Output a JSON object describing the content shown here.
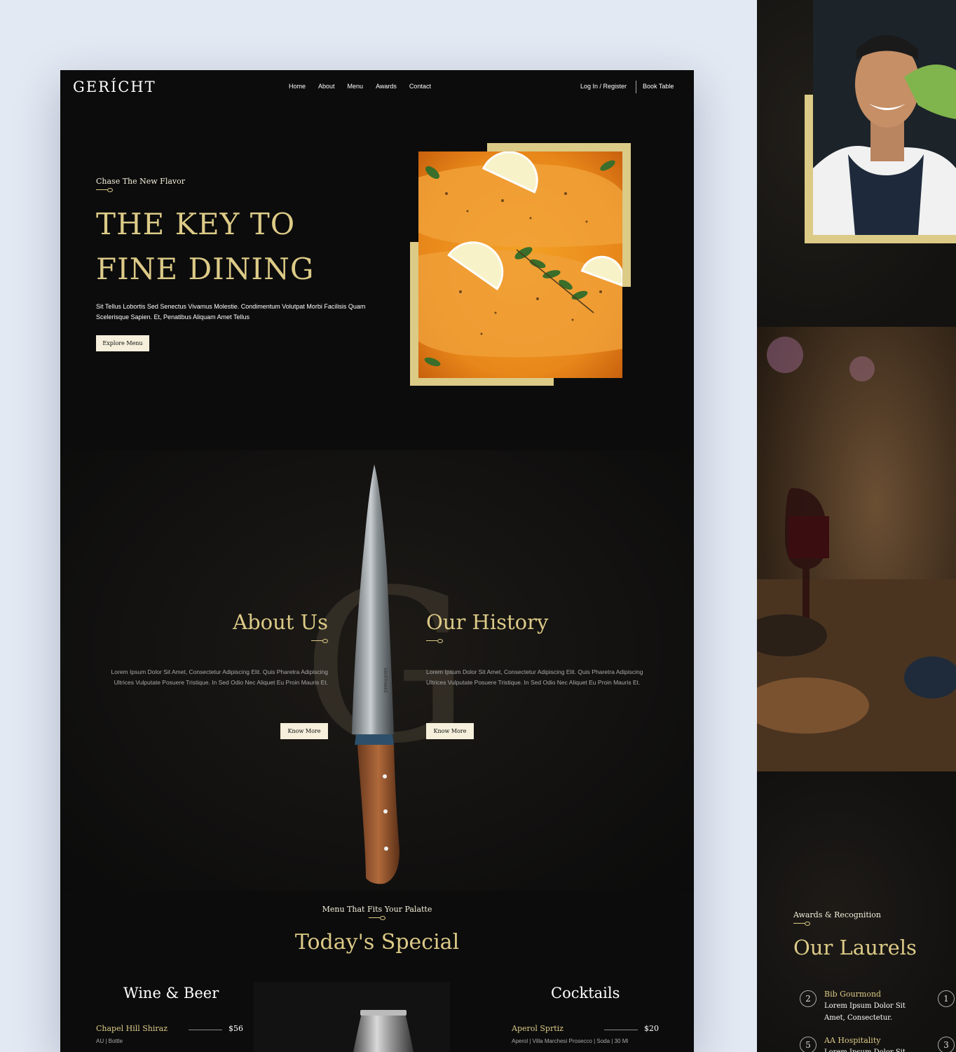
{
  "brand": {
    "logo": "GERÍCHT"
  },
  "nav": {
    "links": [
      "Home",
      "About",
      "Menu",
      "Awards",
      "Contact"
    ],
    "login": "Log In / Register",
    "book": "Book Table"
  },
  "hero": {
    "subtitle": "Chase The New Flavor",
    "title": "THE KEY TO FINE DINING",
    "description": "Sit Tellus Lobortis Sed Senectus Vivamus Molestie. Condimentum Volutpat Morbi Facilisis Quam Scelerisque Sapien. Et, Penatibus Aliquam Amet Tellus",
    "cta": "Explore Menu"
  },
  "about": {
    "title": "About Us",
    "text": "Lorem Ipsum Dolor Sit Amet, Consectetur Adipiscing Elit. Quis Pharetra Adipiscing Ultrices Vulputate Posuere Tristique. In Sed Odio Nec Aliquet Eu Proin Mauris Et.",
    "cta": "Know More",
    "watermark": "G",
    "knife_brand": "SAVERNAKE"
  },
  "history": {
    "title": "Our History",
    "text": "Lorem Ipsum Dolor Sit Amet, Consectetur Adipiscing Elit. Quis Pharetra Adipiscing Ultrices Vulputate Posuere Tristique. In Sed Odio Nec Aliquet Eu Proin Mauris Et.",
    "cta": "Know More"
  },
  "specials": {
    "subtitle": "Menu That Fits Your Palatte",
    "title": "Today's Special",
    "wine": {
      "heading": "Wine & Beer",
      "items": [
        {
          "name": "Chapel Hill Shiraz",
          "price": "$56",
          "tags": "AU | Bottle"
        }
      ]
    },
    "cocktails": {
      "heading": "Cocktails",
      "items": [
        {
          "name": "Aperol Sprtiz",
          "price": "$20",
          "tags": "Aperol | Villa Marchesi Prosecco | Soda | 30 Ml"
        }
      ]
    }
  },
  "laurels": {
    "subtitle": "Awards & Recognition",
    "title": "Our Laurels",
    "awards": [
      {
        "number": "2",
        "name": "Bib Gourmond",
        "desc": "Lorem Ipsum Dolor Sit Amet, Consectetur."
      },
      {
        "number": "5",
        "name": "AA Hospitality",
        "desc": "Lorem Ipsum Dolor Sit"
      }
    ],
    "partial_numbers": [
      "1",
      "3"
    ]
  },
  "colors": {
    "gold": "#dcca87",
    "cream": "#f5efdb",
    "black": "#0c0c0c",
    "backdrop": "#e3e9f3"
  }
}
